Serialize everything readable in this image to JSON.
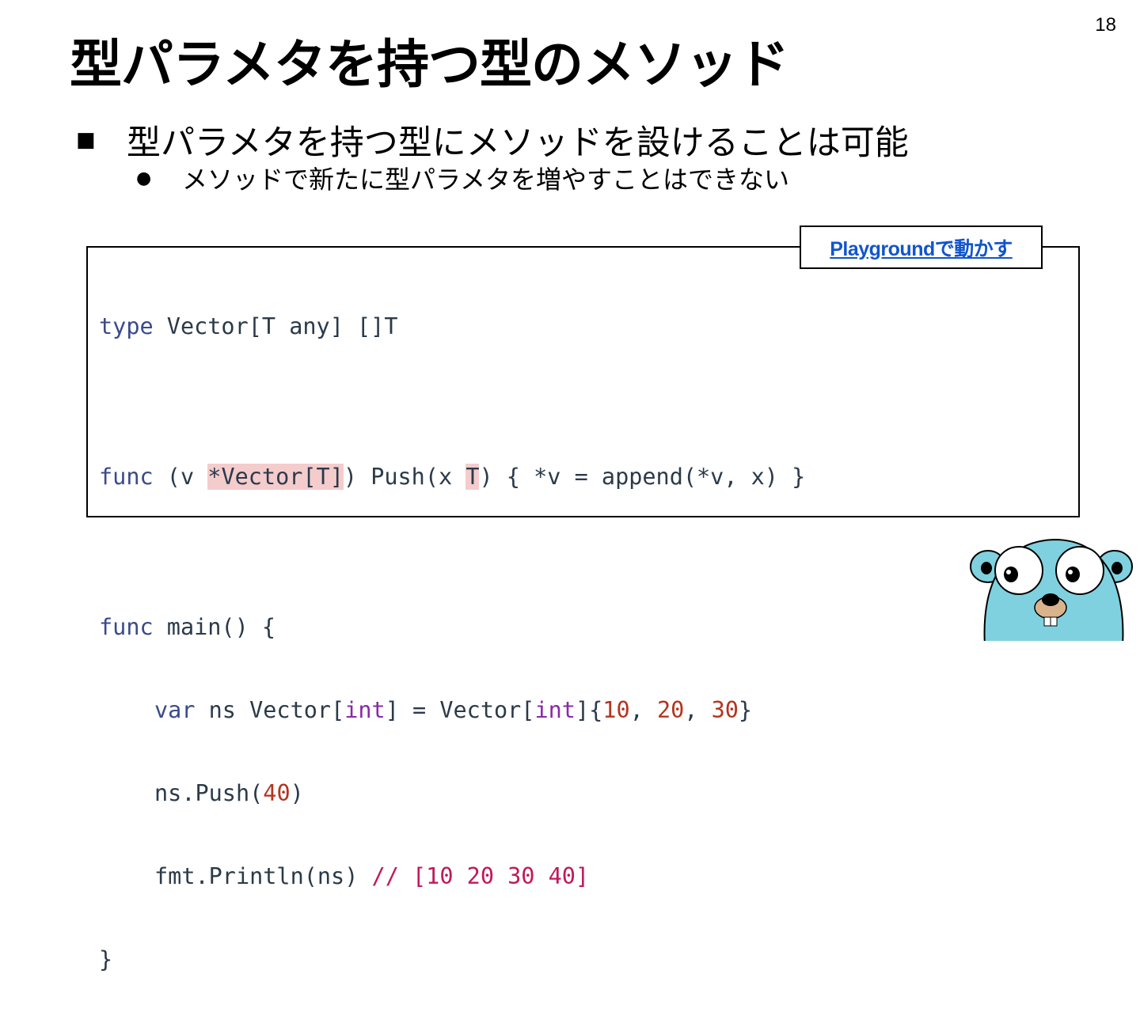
{
  "slide": {
    "number": "18",
    "title": "型パラメタを持つ型のメソッド"
  },
  "bullets": {
    "level1": {
      "marker": "■",
      "text": "型パラメタを持つ型にメソッドを設けることは可能"
    },
    "level2": {
      "marker": "●",
      "text": "メソッドで新たに型パラメタを増やすことはできない"
    }
  },
  "playground_link": {
    "label": "Playgroundで動かす"
  },
  "code": {
    "l1": {
      "kw": "type",
      "rest": " Vector[T any] []T"
    },
    "l2": {
      "kw": "func",
      "a": " (v ",
      "hl1": "*Vector[T]",
      "b": ") Push(x ",
      "hl2": "T",
      "c": ") { *v = append(*v, x) }"
    },
    "l3": {
      "kw": "func",
      "rest": " main() {"
    },
    "l4": {
      "kw": "var",
      "a": " ns Vector[",
      "t1": "int",
      "b": "] = Vector[",
      "t2": "int",
      "c": "]{",
      "n1": "10",
      "s1": ", ",
      "n2": "20",
      "s2": ", ",
      "n3": "30",
      "d": "}"
    },
    "l5": {
      "a": "ns.Push(",
      "n": "40",
      "b": ")"
    },
    "l6": {
      "a": "fmt.Println(ns) ",
      "comment": "// [10 20 30 40]"
    },
    "l7": {
      "a": "}"
    }
  },
  "colors": {
    "keyword": "#3a4a8c",
    "type": "#8a2aa8",
    "number": "#b5341f",
    "comment": "#c2185b",
    "highlight": "#f4cccc",
    "link": "#1155cc",
    "gopher_body": "#7fd1df"
  },
  "icons": {
    "mascot": "go-gopher-icon"
  }
}
